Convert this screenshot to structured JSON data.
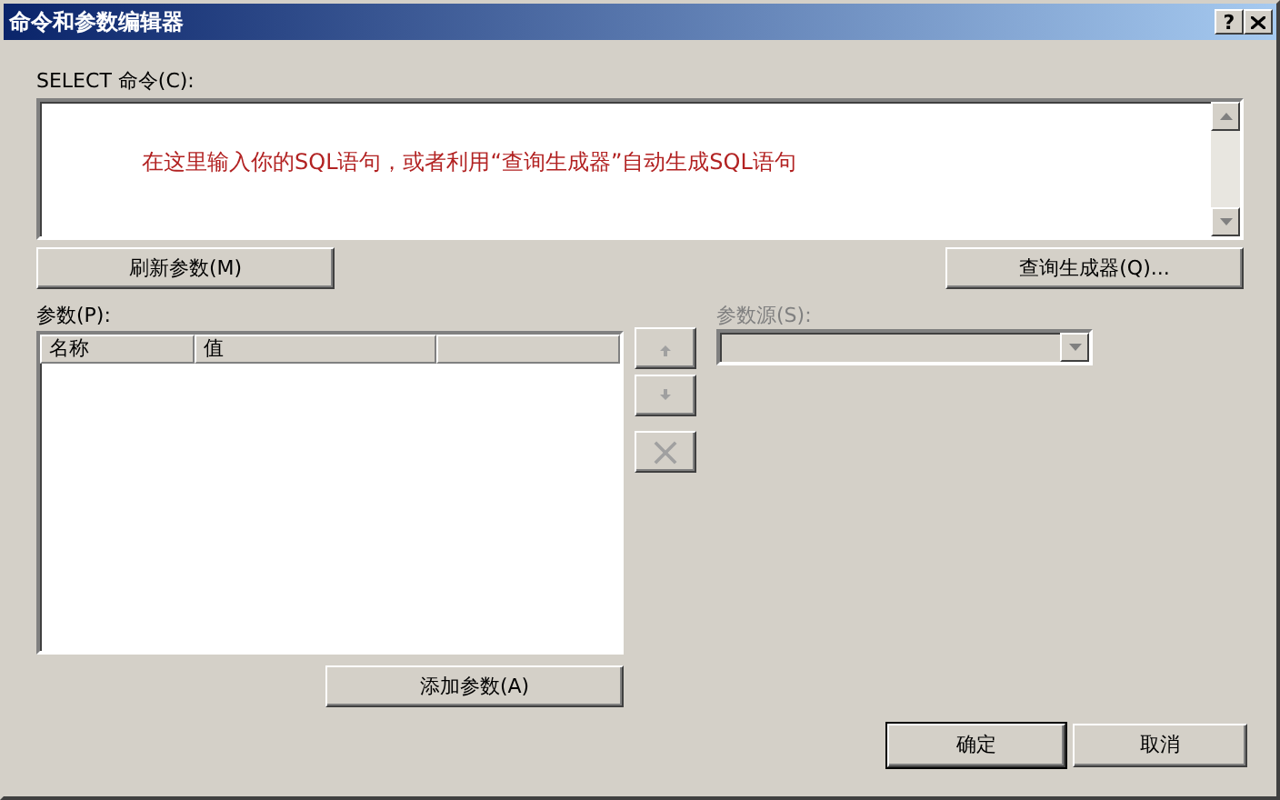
{
  "window": {
    "title": "命令和参数编辑器",
    "help_button": "?"
  },
  "command": {
    "label": "SELECT 命令(C):",
    "text": "在这里输入你的SQL语句，或者利用“查询生成器”自动生成SQL语句"
  },
  "refresh_button": "刷新参数(M)",
  "query_builder_button": "查询生成器(Q)...",
  "parameters": {
    "label": "参数(P):",
    "columns": [
      "名称",
      "值",
      ""
    ]
  },
  "order_buttons": [
    {
      "kind": "up",
      "disabled": true
    },
    {
      "kind": "down",
      "disabled": true
    },
    {
      "kind": "delete",
      "disabled": true
    }
  ],
  "source": {
    "label": "参数源(S):",
    "disabled": true
  },
  "add_button": "添加参数(A)",
  "footer_buttons": [
    "确定",
    "取消"
  ]
}
